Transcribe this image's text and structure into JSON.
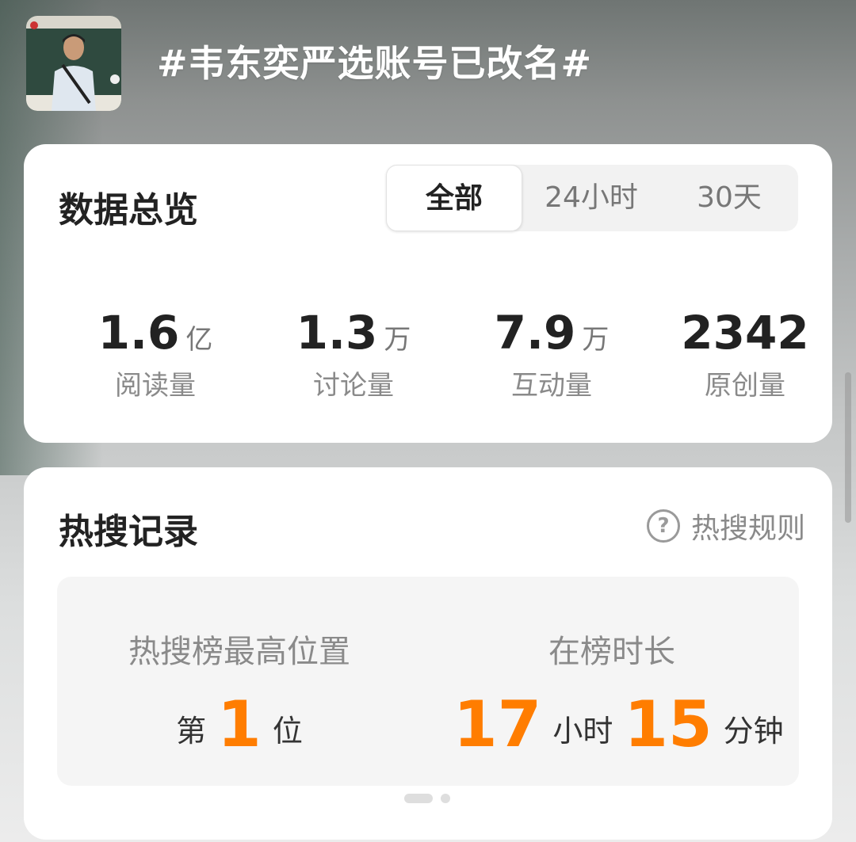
{
  "header": {
    "topic": "#韦东奕严选账号已改名#"
  },
  "overview": {
    "title": "数据总览",
    "tabs": [
      {
        "label": "全部",
        "active": true
      },
      {
        "label": "24小时",
        "active": false
      },
      {
        "label": "30天",
        "active": false
      }
    ],
    "stats": [
      {
        "value": "1.6",
        "unit": "亿",
        "label": "阅读量"
      },
      {
        "value": "1.3",
        "unit": "万",
        "label": "讨论量"
      },
      {
        "value": "7.9",
        "unit": "万",
        "label": "互动量"
      },
      {
        "value": "2342",
        "unit": "",
        "label": "原创量"
      }
    ]
  },
  "hot_search": {
    "title": "热搜记录",
    "rules_label": "热搜规则",
    "rules_icon": "question-circle-icon",
    "peak": {
      "label": "热搜榜最高位置",
      "prefix": "第",
      "value": "1",
      "suffix": "位"
    },
    "duration": {
      "label": "在榜时长",
      "hours": "17",
      "hours_unit": "小时",
      "minutes": "15",
      "minutes_unit": "分钟"
    }
  },
  "colors": {
    "accent": "#ff7d00",
    "card": "#ffffff",
    "text_primary": "#222222",
    "text_secondary": "#8a8a8a"
  }
}
